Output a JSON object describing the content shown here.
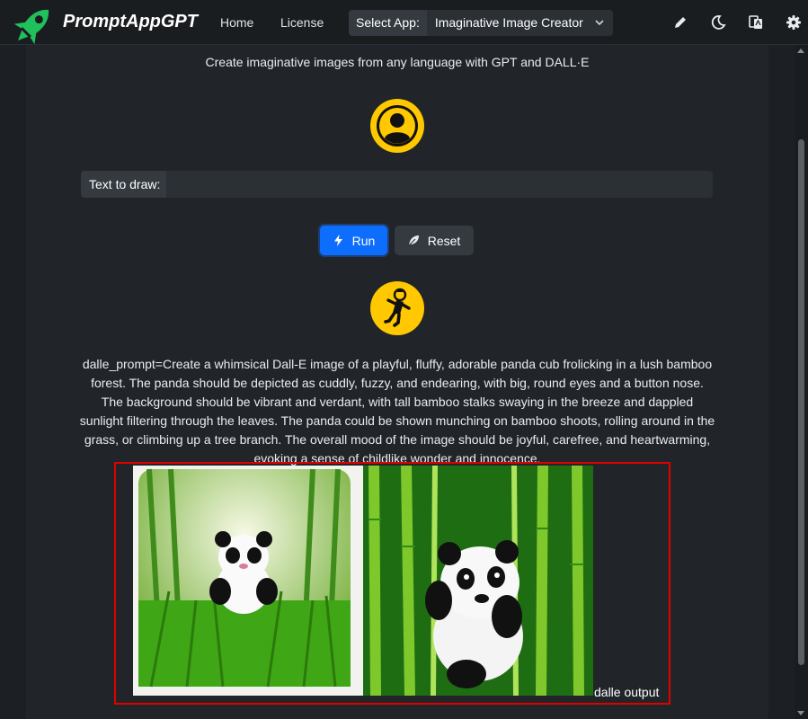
{
  "app": {
    "name": "PromptAppGPT"
  },
  "nav": {
    "home": "Home",
    "license": "License",
    "select_label": "Select App:",
    "selected_app": "Imaginative Image Creator",
    "icons": [
      "pencil-icon",
      "moon-icon",
      "translate-icon",
      "gear-icon"
    ]
  },
  "main": {
    "subtitle": "Create imaginative images from any language with GPT and DALL·E",
    "input_label": "Text to draw:",
    "input_value": "",
    "run_label": "Run",
    "reset_label": "Reset",
    "prompt_text": "dalle_prompt=Create a whimsical Dall-E image of a playful, fluffy, adorable panda cub frolicking in a lush bamboo forest. The panda should be depicted as cuddly, fuzzy, and endearing, with big, round eyes and a button nose. The background should be vibrant and verdant, with tall bamboo stalks swaying in the breeze and dappled sunlight filtering through the leaves. The panda could be shown munching on bamboo shoots, rolling around in the grass, or climbing up a tree branch. The overall mood of the image should be joyful, carefree, and heartwarming, evoking a sense of childlike wonder and innocence.",
    "output_caption": "dalle output"
  },
  "colors": {
    "accent": "#0d6efd",
    "brand_green": "#20c05c",
    "avatar_yellow": "#ffc800",
    "highlight_border": "#e10000"
  }
}
